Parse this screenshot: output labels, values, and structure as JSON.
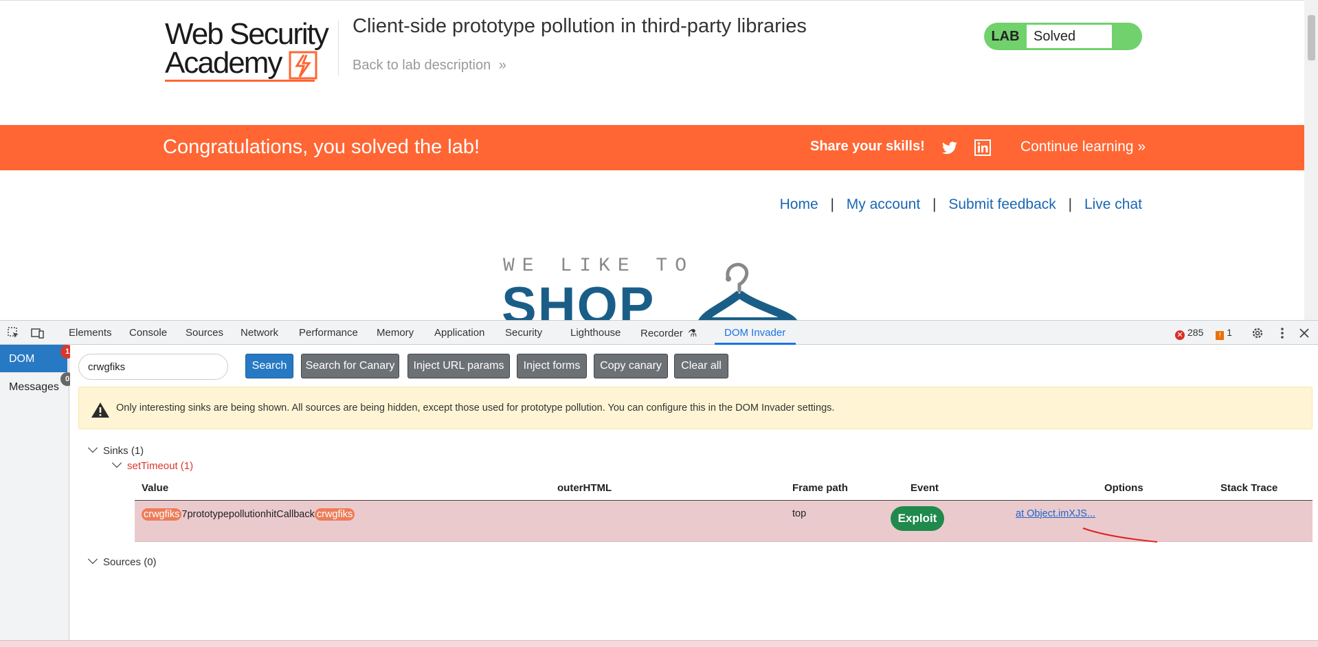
{
  "lab": {
    "logo_line1": "Web Security",
    "logo_line2": "Academy",
    "title": "Client-side prototype pollution in third-party libraries",
    "back_link": "Back to lab description",
    "status_label": "LAB",
    "status_value": "Solved",
    "status_color": "#70d16d"
  },
  "banner": {
    "message": "Congratulations, you solved the lab!",
    "share": "Share your skills!",
    "continue": "Continue learning",
    "color": "#ff6633"
  },
  "nav": {
    "home": "Home",
    "sep": "|",
    "account": "My account",
    "feedback": "Submit feedback",
    "chat": "Live chat"
  },
  "shop_logo": {
    "line1": "WE LIKE TO",
    "line2": "SHOP"
  },
  "devtools": {
    "tabs": [
      "Elements",
      "Console",
      "Sources",
      "Network",
      "Performance",
      "Memory",
      "Application",
      "Security",
      "Lighthouse",
      "Recorder",
      "DOM Invader"
    ],
    "active_tab": "DOM Invader",
    "error_count": "285",
    "warning_count": "1"
  },
  "invader": {
    "side_dom": "DOM",
    "side_dom_badge": "1",
    "side_messages": "Messages",
    "side_messages_badge": "0",
    "canary_value": "crwgfiks",
    "buttons": {
      "search": "Search",
      "search_canary": "Search for Canary",
      "inject_url": "Inject URL params",
      "inject_forms": "Inject forms",
      "copy_canary": "Copy canary",
      "clear_all": "Clear all"
    },
    "alert": "Only interesting sinks are being shown. All sources are being hidden, except those used for prototype pollution. You can configure this in the DOM Invader settings.",
    "sinks_label": "Sinks (1)",
    "sink_name": "setTimeout (1)",
    "columns": [
      "Value",
      "outerHTML",
      "Frame path",
      "Event",
      "Options",
      "Stack Trace"
    ],
    "row": {
      "value_prefix": "crwgfiks",
      "value_middle": "7prototypepollutionhitCallback",
      "value_suffix": "crwgfiks",
      "outer_html": "",
      "frame_path": "top",
      "event": "",
      "option": "Exploit",
      "stack_trace": "at Object.imXJS..."
    },
    "sources_label": "Sources (0)"
  }
}
